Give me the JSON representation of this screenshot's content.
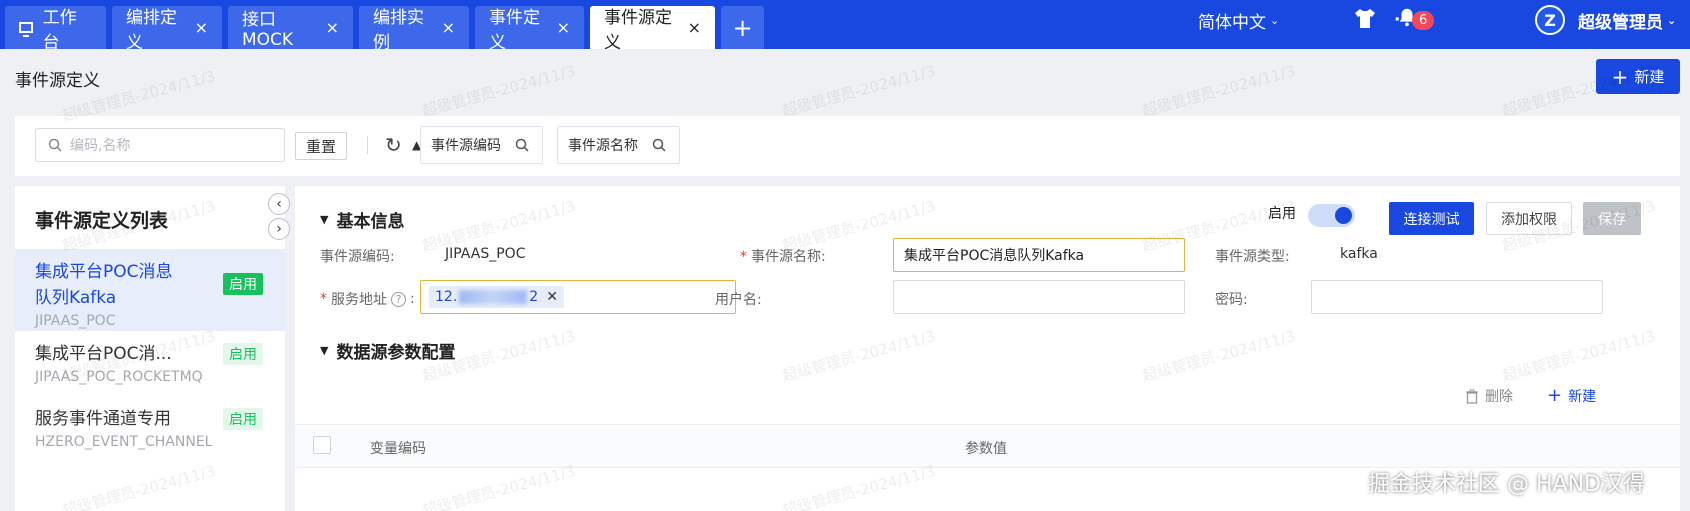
{
  "tabs": [
    {
      "label": "工作台",
      "closable": false,
      "active": false
    },
    {
      "label": "编排定义",
      "closable": true,
      "active": false
    },
    {
      "label": "接口MOCK",
      "closable": true,
      "active": false
    },
    {
      "label": "编排实例",
      "closable": true,
      "active": false
    },
    {
      "label": "事件定义",
      "closable": true,
      "active": false
    },
    {
      "label": "事件源定义",
      "closable": true,
      "active": true
    }
  ],
  "tab_close_glyph": "×",
  "add_tab_glyph": "+",
  "header_right": {
    "language": "简体中文",
    "notification_count": "6",
    "more_glyph": "···",
    "avatar_letter": "Z",
    "user": "超级管理员"
  },
  "page": {
    "title": "事件源定义",
    "new_button": "新建"
  },
  "filter": {
    "search_placeholder": "编码,名称",
    "reset": "重置",
    "chip_code": "事件源编码",
    "chip_name": "事件源名称"
  },
  "list": {
    "title": "事件源定义列表",
    "items": [
      {
        "name_line1": "集成平台POC消息",
        "name_line2": "队列Kafka",
        "code": "JIPAAS_POC",
        "status": "启用"
      },
      {
        "name_line1": "集成平台POC消...",
        "code": "JIPAAS_POC_ROCKETMQ",
        "status": "启用"
      },
      {
        "name_line1": "服务事件通道专用",
        "code": "HZERO_EVENT_CHANNEL",
        "status": "启用"
      }
    ]
  },
  "basic": {
    "section_title": "基本信息",
    "enable_label": "启用",
    "enabled": true,
    "btn_test": "连接测试",
    "btn_perm": "添加权限",
    "btn_save": "保存",
    "code_label": "事件源编码:",
    "code_value": "JIPAAS_POC",
    "name_label": "事件源名称:",
    "name_value": "集成平台POC消息队列Kafka",
    "type_label": "事件源类型:",
    "type_value": "kafka",
    "addr_label": "服务地址",
    "addr_prefix": "12.",
    "addr_suffix": "2",
    "user_label": "用户名:",
    "user_value": "",
    "pwd_label": "密码:",
    "pwd_value": ""
  },
  "params": {
    "section_title": "数据源参数配置",
    "delete": "删除",
    "new": "新建",
    "col_var": "变量编码",
    "col_value": "参数值"
  },
  "watermark_text": "超级管理员-2024/11/3",
  "signature": "掘金技术社区 @ HAND汉得",
  "colors": {
    "primary": "#1848e0",
    "success": "#17c15b",
    "warning_border": "#e3b53c"
  }
}
